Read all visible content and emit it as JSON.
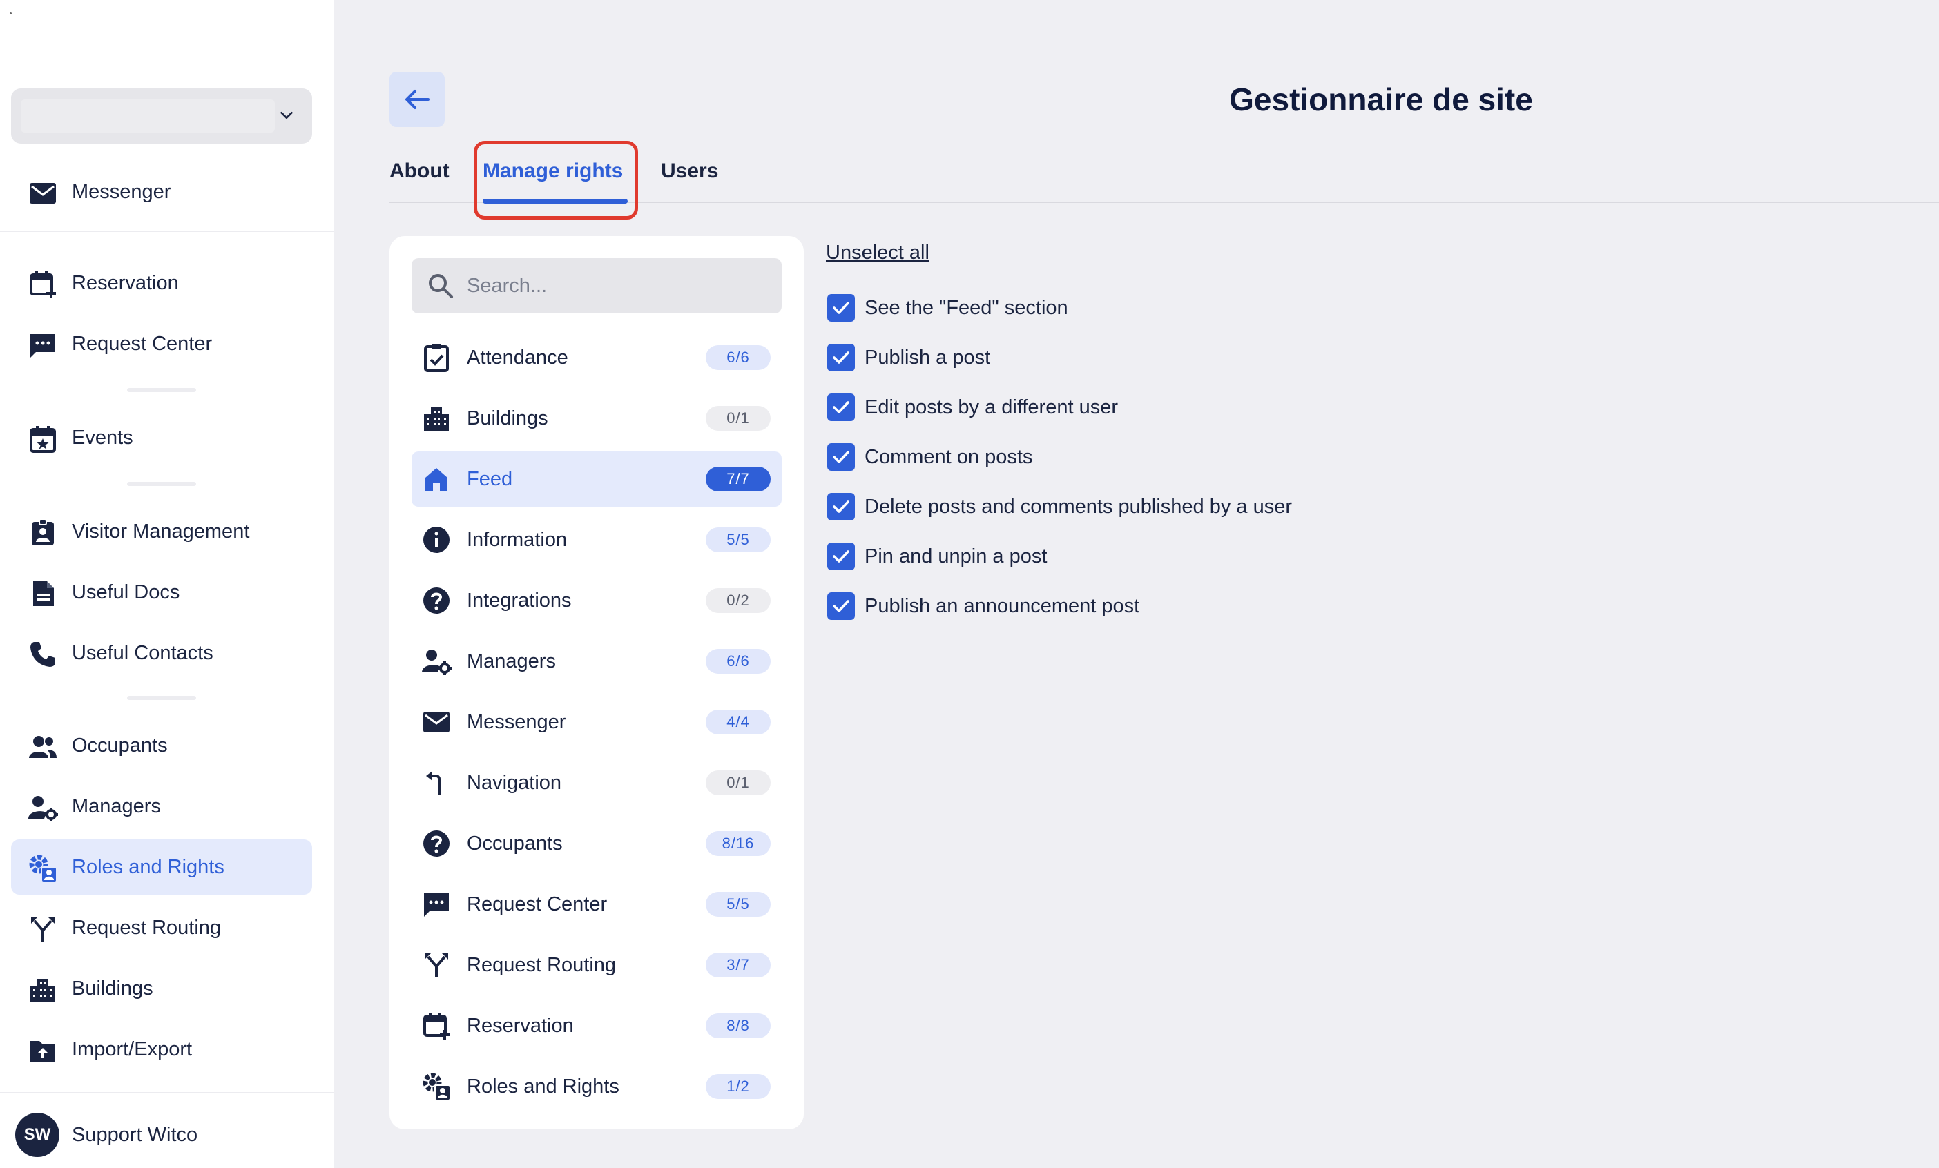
{
  "sidebar": {
    "selector": {
      "value": ""
    },
    "items": [
      {
        "label": "Messenger",
        "icon": "mail-icon"
      },
      {
        "label": "Reservation",
        "icon": "calendar-plus-icon"
      },
      {
        "label": "Request Center",
        "icon": "chat-icon"
      },
      {
        "label": "Events",
        "icon": "calendar-star-icon"
      },
      {
        "label": "Visitor Management",
        "icon": "badge-icon"
      },
      {
        "label": "Useful Docs",
        "icon": "document-icon"
      },
      {
        "label": "Useful Contacts",
        "icon": "phone-icon"
      },
      {
        "label": "Occupants",
        "icon": "people-icon"
      },
      {
        "label": "Managers",
        "icon": "user-gear-icon"
      },
      {
        "label": "Roles and Rights",
        "icon": "gear-user-icon"
      },
      {
        "label": "Request Routing",
        "icon": "routing-icon"
      },
      {
        "label": "Buildings",
        "icon": "building-icon"
      },
      {
        "label": "Import/Export",
        "icon": "folder-upload-icon"
      }
    ],
    "active_item": "Roles and Rights",
    "user": {
      "initials": "SW",
      "name": "Support Witco"
    }
  },
  "header": {
    "title": "Gestionnaire de site"
  },
  "tabs": [
    {
      "label": "About"
    },
    {
      "label": "Manage rights"
    },
    {
      "label": "Users"
    }
  ],
  "active_tab": "Manage rights",
  "search": {
    "placeholder": "Search..."
  },
  "categories": [
    {
      "label": "Attendance",
      "count": "6/6",
      "icon": "clipboard-check-icon"
    },
    {
      "label": "Buildings",
      "count": "0/1",
      "icon": "building-icon"
    },
    {
      "label": "Feed",
      "count": "7/7",
      "icon": "home-icon"
    },
    {
      "label": "Information",
      "count": "5/5",
      "icon": "info-icon"
    },
    {
      "label": "Integrations",
      "count": "0/2",
      "icon": "help-icon"
    },
    {
      "label": "Managers",
      "count": "6/6",
      "icon": "user-gear-icon"
    },
    {
      "label": "Messenger",
      "count": "4/4",
      "icon": "mail-icon"
    },
    {
      "label": "Navigation",
      "count": "0/1",
      "icon": "turn-icon"
    },
    {
      "label": "Occupants",
      "count": "8/16",
      "icon": "help-icon"
    },
    {
      "label": "Request Center",
      "count": "5/5",
      "icon": "chat-icon"
    },
    {
      "label": "Request Routing",
      "count": "3/7",
      "icon": "routing-icon"
    },
    {
      "label": "Reservation",
      "count": "8/8",
      "icon": "calendar-plus-icon"
    },
    {
      "label": "Roles and Rights",
      "count": "1/2",
      "icon": "gear-user-icon"
    }
  ],
  "active_category": "Feed",
  "permissions": {
    "unselect_label": "Unselect all",
    "items": [
      {
        "label": "See the \"Feed\" section",
        "checked": true
      },
      {
        "label": "Publish a post",
        "checked": true
      },
      {
        "label": "Edit posts by a different user",
        "checked": true
      },
      {
        "label": "Comment on posts",
        "checked": true
      },
      {
        "label": "Delete posts and comments published by a user",
        "checked": true
      },
      {
        "label": "Pin and unpin a post",
        "checked": true
      },
      {
        "label": "Publish an announcement post",
        "checked": true
      }
    ]
  },
  "colors": {
    "accent": "#2f5fd7",
    "highlight": "#e03a2e",
    "text": "#1b2440"
  }
}
